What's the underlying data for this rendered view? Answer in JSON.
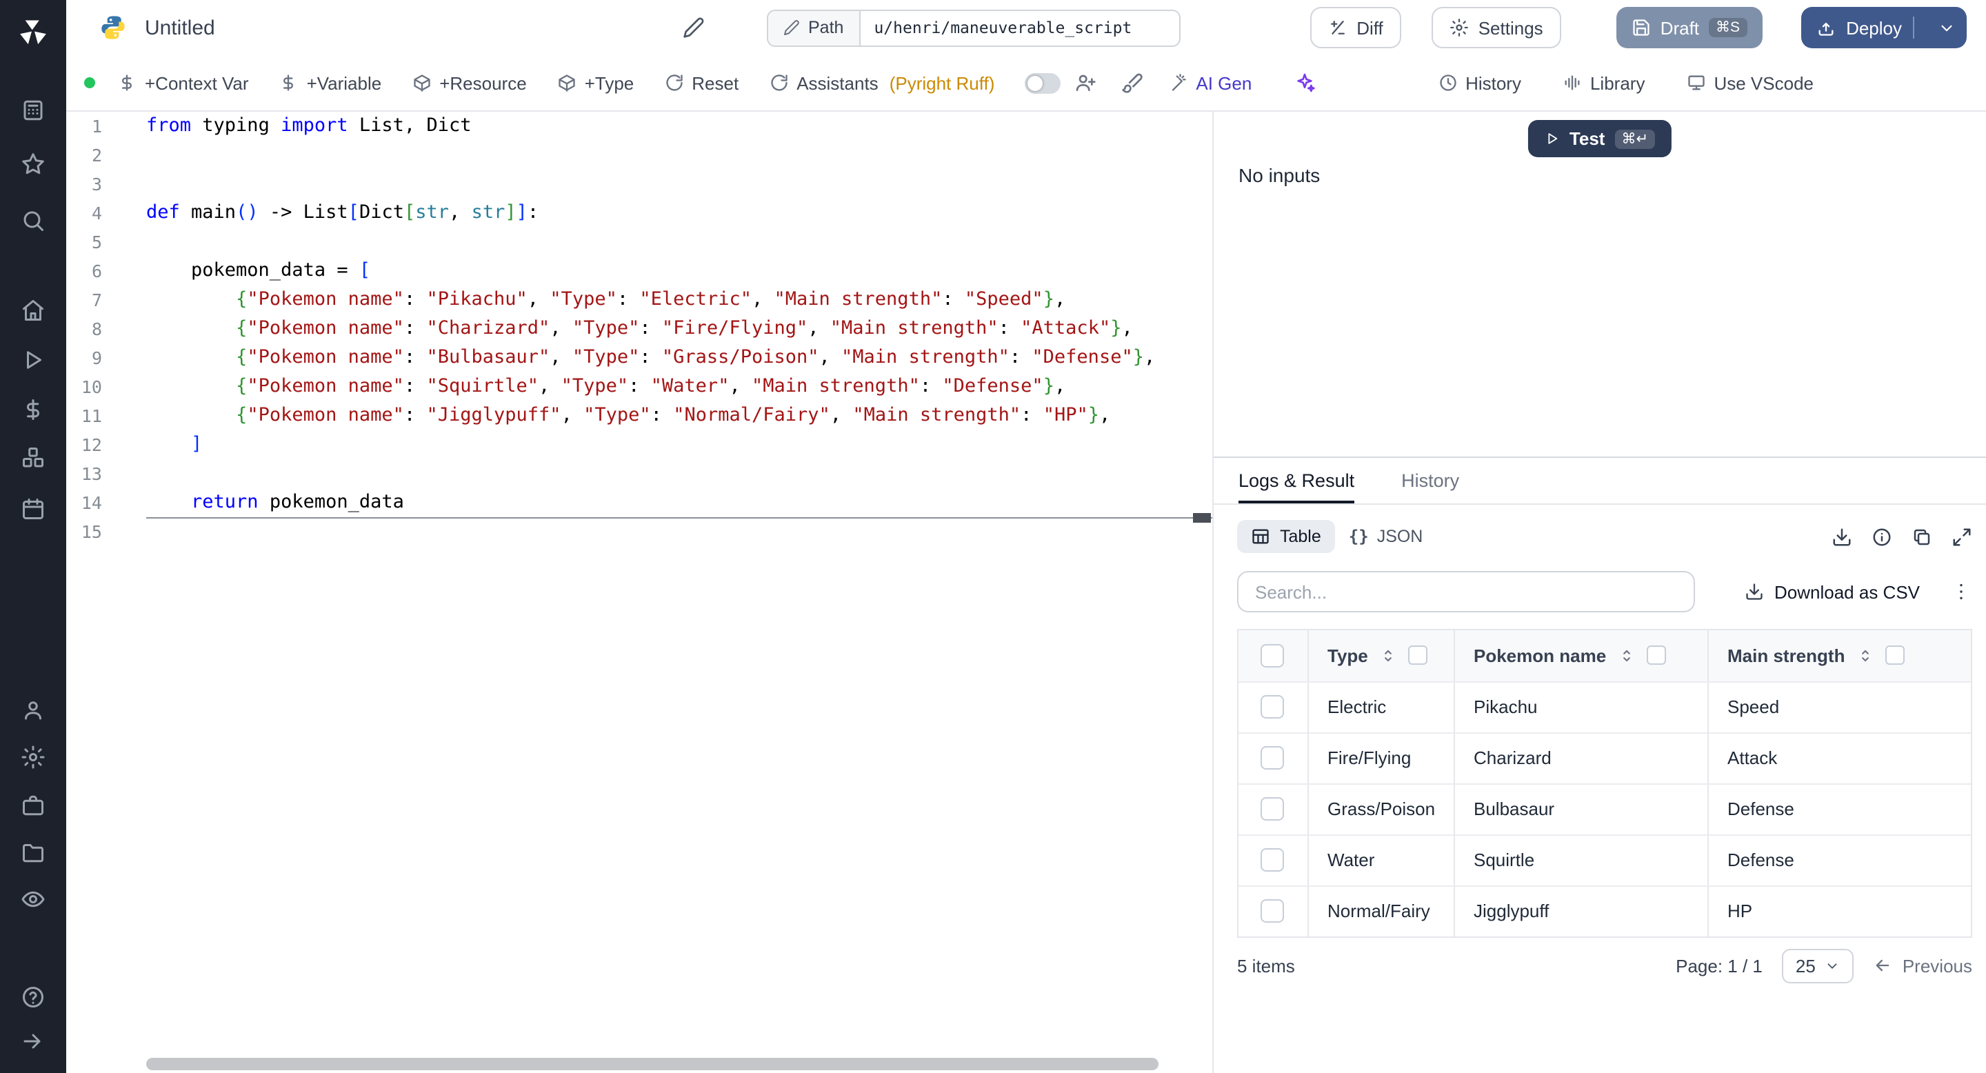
{
  "topbar": {
    "title": "Untitled",
    "path_label": "Path",
    "path_value": "u/henri/maneuverable_script",
    "diff": "Diff",
    "settings": "Settings",
    "draft": "Draft",
    "draft_shortcut": "⌘S",
    "deploy": "Deploy"
  },
  "toolbar": {
    "context_var": "+Context Var",
    "variable": "+Variable",
    "resource": "+Resource",
    "type": "+Type",
    "reset": "Reset",
    "assistants": "Assistants",
    "assistants_detail": "(Pyright Ruff)",
    "ai_gen": "AI Gen",
    "history": "History",
    "library": "Library",
    "use_vscode": "Use VScode"
  },
  "editor": {
    "lines": [
      {
        "n": "1",
        "t": [
          [
            "kw",
            "from"
          ],
          [
            "pl",
            " typing "
          ],
          [
            "kw",
            "import"
          ],
          [
            "pl",
            " List, Dict"
          ]
        ]
      },
      {
        "n": "2",
        "t": []
      },
      {
        "n": "3",
        "t": []
      },
      {
        "n": "4",
        "t": [
          [
            "kw",
            "def"
          ],
          [
            "pl",
            " main"
          ],
          [
            "b1",
            "()"
          ],
          [
            "pl",
            " -> List"
          ],
          [
            "b1",
            "["
          ],
          [
            "pl",
            "Dict"
          ],
          [
            "b2",
            "["
          ],
          [
            "ty",
            "str"
          ],
          [
            "pl",
            ", "
          ],
          [
            "ty",
            "str"
          ],
          [
            "b2",
            "]"
          ],
          [
            "b1",
            "]"
          ],
          [
            "pl",
            ":"
          ]
        ]
      },
      {
        "n": "5",
        "t": []
      },
      {
        "n": "6",
        "t": [
          [
            "pl",
            "    pokemon_data = "
          ],
          [
            "b1",
            "["
          ]
        ]
      },
      {
        "n": "7",
        "t": [
          [
            "pl",
            "        "
          ],
          [
            "b2",
            "{"
          ],
          [
            "st",
            "\"Pokemon name\""
          ],
          [
            "pl",
            ": "
          ],
          [
            "st",
            "\"Pikachu\""
          ],
          [
            "pl",
            ", "
          ],
          [
            "st",
            "\"Type\""
          ],
          [
            "pl",
            ": "
          ],
          [
            "st",
            "\"Electric\""
          ],
          [
            "pl",
            ", "
          ],
          [
            "st",
            "\"Main strength\""
          ],
          [
            "pl",
            ": "
          ],
          [
            "st",
            "\"Speed\""
          ],
          [
            "b2",
            "}"
          ],
          [
            "pl",
            ","
          ]
        ]
      },
      {
        "n": "8",
        "t": [
          [
            "pl",
            "        "
          ],
          [
            "b2",
            "{"
          ],
          [
            "st",
            "\"Pokemon name\""
          ],
          [
            "pl",
            ": "
          ],
          [
            "st",
            "\"Charizard\""
          ],
          [
            "pl",
            ", "
          ],
          [
            "st",
            "\"Type\""
          ],
          [
            "pl",
            ": "
          ],
          [
            "st",
            "\"Fire/Flying\""
          ],
          [
            "pl",
            ", "
          ],
          [
            "st",
            "\"Main strength\""
          ],
          [
            "pl",
            ": "
          ],
          [
            "st",
            "\"Attack\""
          ],
          [
            "b2",
            "}"
          ],
          [
            "pl",
            ","
          ]
        ]
      },
      {
        "n": "9",
        "t": [
          [
            "pl",
            "        "
          ],
          [
            "b2",
            "{"
          ],
          [
            "st",
            "\"Pokemon name\""
          ],
          [
            "pl",
            ": "
          ],
          [
            "st",
            "\"Bulbasaur\""
          ],
          [
            "pl",
            ", "
          ],
          [
            "st",
            "\"Type\""
          ],
          [
            "pl",
            ": "
          ],
          [
            "st",
            "\"Grass/Poison\""
          ],
          [
            "pl",
            ", "
          ],
          [
            "st",
            "\"Main strength\""
          ],
          [
            "pl",
            ": "
          ],
          [
            "st",
            "\"Defense\""
          ],
          [
            "b2",
            "}"
          ],
          [
            "pl",
            ","
          ]
        ]
      },
      {
        "n": "10",
        "t": [
          [
            "pl",
            "        "
          ],
          [
            "b2",
            "{"
          ],
          [
            "st",
            "\"Pokemon name\""
          ],
          [
            "pl",
            ": "
          ],
          [
            "st",
            "\"Squirtle\""
          ],
          [
            "pl",
            ", "
          ],
          [
            "st",
            "\"Type\""
          ],
          [
            "pl",
            ": "
          ],
          [
            "st",
            "\"Water\""
          ],
          [
            "pl",
            ", "
          ],
          [
            "st",
            "\"Main strength\""
          ],
          [
            "pl",
            ": "
          ],
          [
            "st",
            "\"Defense\""
          ],
          [
            "b2",
            "}"
          ],
          [
            "pl",
            ","
          ]
        ]
      },
      {
        "n": "11",
        "t": [
          [
            "pl",
            "        "
          ],
          [
            "b2",
            "{"
          ],
          [
            "st",
            "\"Pokemon name\""
          ],
          [
            "pl",
            ": "
          ],
          [
            "st",
            "\"Jigglypuff\""
          ],
          [
            "pl",
            ", "
          ],
          [
            "st",
            "\"Type\""
          ],
          [
            "pl",
            ": "
          ],
          [
            "st",
            "\"Normal/Fairy\""
          ],
          [
            "pl",
            ", "
          ],
          [
            "st",
            "\"Main strength\""
          ],
          [
            "pl",
            ": "
          ],
          [
            "st",
            "\"HP\""
          ],
          [
            "b2",
            "}"
          ],
          [
            "pl",
            ","
          ]
        ]
      },
      {
        "n": "12",
        "t": [
          [
            "pl",
            "    "
          ],
          [
            "b1",
            "]"
          ]
        ]
      },
      {
        "n": "13",
        "t": []
      },
      {
        "n": "14",
        "t": [
          [
            "pl",
            "    "
          ],
          [
            "kw",
            "return"
          ],
          [
            "pl",
            " pokemon_data"
          ]
        ]
      },
      {
        "n": "15",
        "t": [],
        "cur": true
      }
    ]
  },
  "preview": {
    "test_label": "Test",
    "test_shortcut": "⌘↵",
    "no_inputs": "No inputs"
  },
  "results": {
    "tab_logs": "Logs & Result",
    "tab_history": "History",
    "view_table": "Table",
    "view_json": "JSON",
    "json_icon": "{}",
    "search_placeholder": "Search...",
    "download_csv": "Download as CSV",
    "table": {
      "columns": [
        "Type",
        "Pokemon name",
        "Main strength"
      ],
      "rows": [
        [
          "Electric",
          "Pikachu",
          "Speed"
        ],
        [
          "Fire/Flying",
          "Charizard",
          "Attack"
        ],
        [
          "Grass/Poison",
          "Bulbasaur",
          "Defense"
        ],
        [
          "Water",
          "Squirtle",
          "Defense"
        ],
        [
          "Normal/Fairy",
          "Jigglypuff",
          "HP"
        ]
      ]
    },
    "footer": {
      "items": "5 items",
      "page": "Page: 1 / 1",
      "page_size": "25",
      "previous": "Previous"
    }
  }
}
